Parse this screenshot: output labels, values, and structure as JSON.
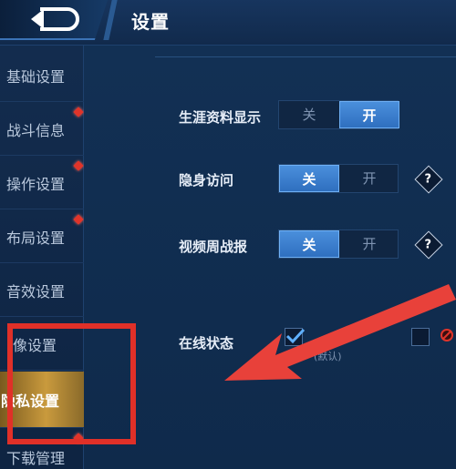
{
  "header": {
    "title": "设置"
  },
  "sidebar": {
    "items": [
      {
        "label": "基础设置",
        "dot": false,
        "active": false
      },
      {
        "label": "战斗信息",
        "dot": true,
        "active": false
      },
      {
        "label": "操作设置",
        "dot": true,
        "active": false
      },
      {
        "label": "布局设置",
        "dot": true,
        "active": false
      },
      {
        "label": "音效设置",
        "dot": false,
        "active": false
      },
      {
        "label": "像设置",
        "dot": false,
        "active": false
      },
      {
        "label": "隐私设置",
        "dot": false,
        "active": true
      },
      {
        "label": "下载管理",
        "dot": true,
        "active": false
      }
    ]
  },
  "settings": {
    "career": {
      "label": "生涯资料显示",
      "off": "关",
      "on": "开",
      "selected": "on"
    },
    "invisible": {
      "label": "隐身访问",
      "off": "关",
      "on": "开",
      "selected": "off",
      "help": "?"
    },
    "weekly": {
      "label": "视频周战报",
      "off": "关",
      "on": "开",
      "selected": "off",
      "help": "?"
    },
    "online": {
      "label": "在线状态",
      "default_hint": "(默认)"
    }
  },
  "colors": {
    "accent": "#3f82d2",
    "active_tab": "#c99a3d",
    "annotation": "#e03028"
  }
}
